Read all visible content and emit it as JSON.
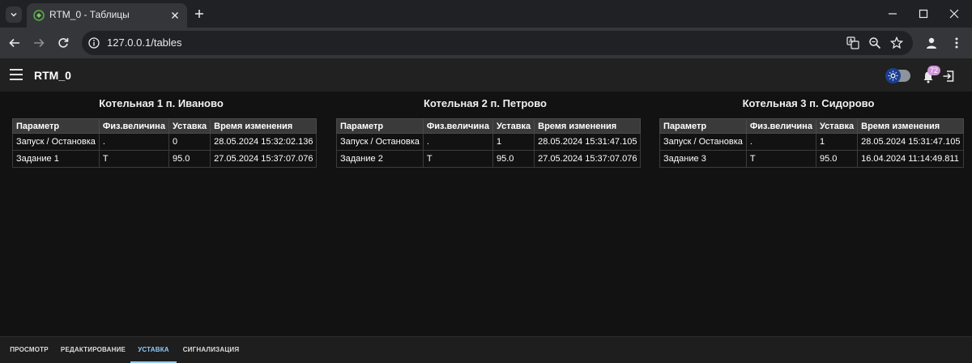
{
  "browser": {
    "tab_title": "RTM_0 - Таблицы",
    "url": "127.0.0.1/tables"
  },
  "app": {
    "title": "RTM_0",
    "notification_count": "72"
  },
  "tables": [
    {
      "title": "Котельная 1 п. Иваново",
      "columns": [
        "Параметр",
        "Физ.величина",
        "Уставка",
        "Время изменения"
      ],
      "rows": [
        [
          "Запуск / Остановка",
          ".",
          "0",
          "28.05.2024 15:32:02.136"
        ],
        [
          "Задание 1",
          "T",
          "95.0",
          "27.05.2024 15:37:07.076"
        ]
      ]
    },
    {
      "title": "Котельная 2 п. Петрово",
      "columns": [
        "Параметр",
        "Физ.величина",
        "Уставка",
        "Время изменения"
      ],
      "rows": [
        [
          "Запуск / Остановка",
          ".",
          "1",
          "28.05.2024 15:31:47.105"
        ],
        [
          "Задание 2",
          "T",
          "95.0",
          "27.05.2024 15:37:07.076"
        ]
      ]
    },
    {
      "title": "Котельная 3 п. Сидорово",
      "columns": [
        "Параметр",
        "Физ.величина",
        "Уставка",
        "Время изменения"
      ],
      "rows": [
        [
          "Запуск / Остановка",
          ".",
          "1",
          "28.05.2024 15:31:47.105"
        ],
        [
          "Задание 3",
          "T",
          "95.0",
          "16.04.2024 11:14:49.811"
        ]
      ]
    }
  ],
  "bottom_tabs": [
    {
      "label": "ПРОСМОТР"
    },
    {
      "label": "РЕДАКТИРОВАНИЕ"
    },
    {
      "label": "УСТАВКА"
    },
    {
      "label": "СИГНАЛИЗАЦИЯ"
    }
  ],
  "colors": {
    "accent": "#90caf9",
    "badge": "#ce93d8",
    "background": "#121212"
  }
}
